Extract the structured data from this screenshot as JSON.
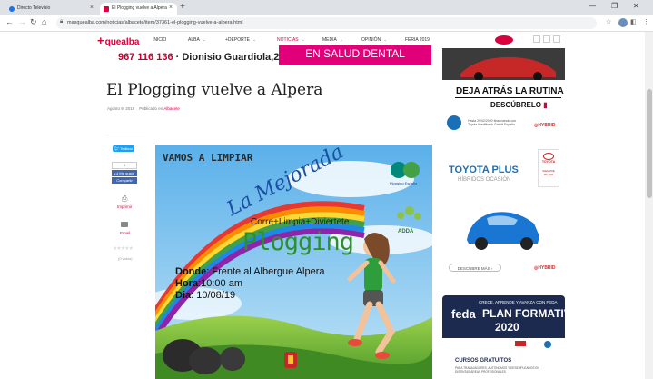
{
  "browser": {
    "tabs": [
      {
        "title": "Directo Televisio",
        "active": false
      },
      {
        "title": "El Plogging vuelve a Alpera",
        "active": true
      }
    ],
    "url": "masquealba.com/noticias/albacete/item/37361-el-plogging-vuelve-a-alpera.html"
  },
  "site": {
    "logo": "quealba",
    "nav": [
      "INICIO",
      "ALBA",
      "+DEPORTE",
      "NOTICIAS",
      "MEDIA",
      "OPINIÓN",
      "FERIA 2019"
    ],
    "top_ad_phone": "967 116 136",
    "top_ad_name": "· Dionisio Guardiola,2",
    "top_ad_pink": "EN SALUD DENTAL"
  },
  "article": {
    "title": "El Plogging vuelve a Alpera",
    "date": "Agosto 9, 2019",
    "published_in_label": "Publicado en",
    "category": "Albacete",
    "share": {
      "tweet": "Twittear",
      "like_count": "0",
      "like": "Me gusta",
      "share": "Compartir",
      "print": "Imprimir",
      "email": "Email",
      "votes": "(0 votos)"
    },
    "poster": {
      "headline": "VAMOS A LIMPIAR",
      "brand": "La Mejorada",
      "tagline": "Corre+Limpia+Diviertete",
      "event": "Plogging",
      "logo1": "Plogging España",
      "logo2": "ADDA",
      "where_label": "Donde",
      "where": ": Frente al Albergue Alpera",
      "time_label": "Hora",
      "time": ":10:00 am",
      "day_label": "Dia",
      "day": ": 10/08/19"
    }
  },
  "sidebar": {
    "rutina": "DEJA ATRÁS LA RUTINA",
    "descubrelo": "DESCÚBRELO",
    "fine_print": "Hasta 29/02/2020 financiando con Toyota Kreditbank GmbH España",
    "hybrid": "HYBRID",
    "toyota_plus": "TOYOTA PLUS",
    "hibridos": "HÍBRIDOS OCASIÓN",
    "toyota": "TOYOTA",
    "siempre": "SIEMPRE MEJOR",
    "descubre_mas": "DESCUBRE MÁS",
    "feda_small": "CRECE, APRENDE Y AVANZA CON FEDA",
    "feda": "feda",
    "plan": "PLAN FORMATIVO",
    "year": "2020",
    "cursos": "CURSOS GRATUITOS",
    "cursos_sub": "PARA TRABAJADORES, AUTÓNOMOS Y DESEMPLEADOS EN DISTINTAS ÁREAS PROFESIONALES"
  },
  "colors": {
    "brand": "#d8003d",
    "toyota_blue": "#1a6fb5",
    "feda_navy": "#1b2a4e",
    "pink_ad": "#e2007a"
  }
}
